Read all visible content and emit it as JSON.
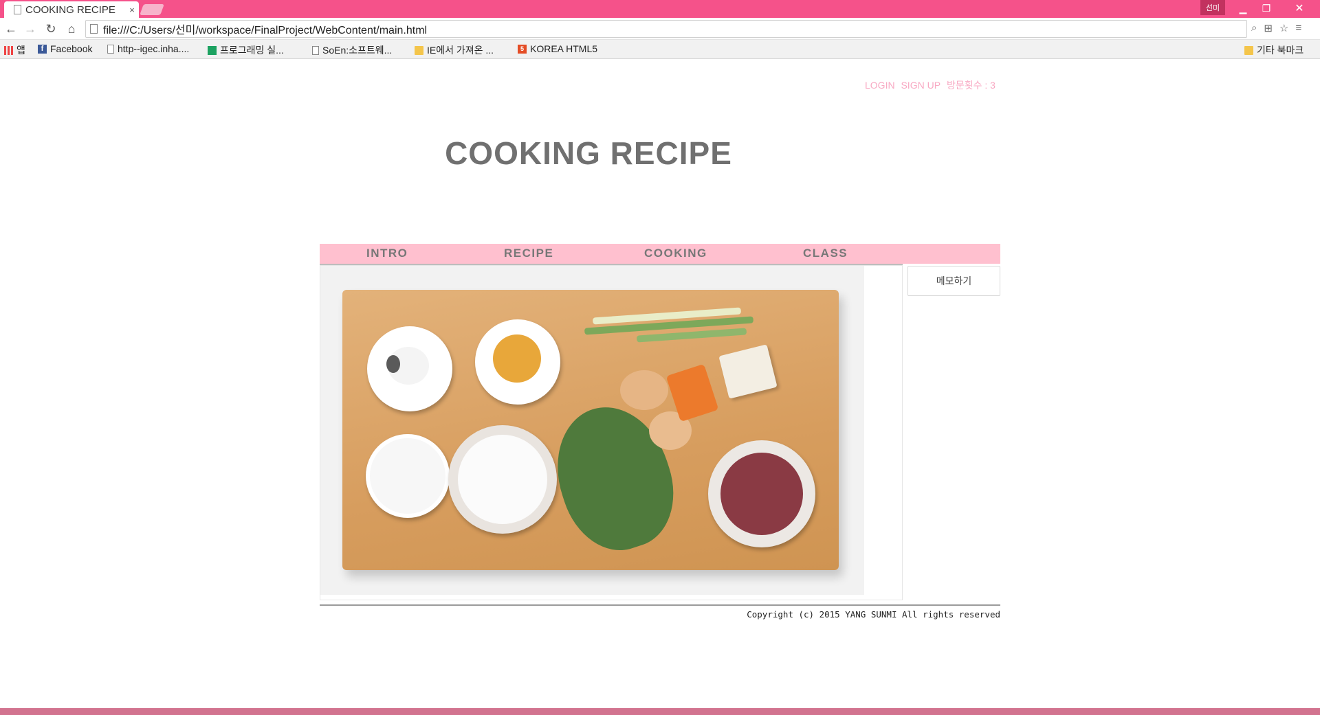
{
  "browser": {
    "tab_title": "COOKING RECIPE",
    "tab_close": "×",
    "profile_name": "선미",
    "url": "file:///C:/Users/선미/workspace/FinalProject/WebContent/main.html",
    "bookmarks": [
      {
        "label": "앱",
        "icon": "apps-icon"
      },
      {
        "label": "Facebook",
        "icon": "facebook-icon"
      },
      {
        "label": "http--igec.inha....",
        "icon": "page-icon"
      },
      {
        "label": "프로그래밍 실...",
        "icon": "sheet-icon"
      },
      {
        "label": "SoEn:소프트웨...",
        "icon": "page-icon"
      },
      {
        "label": "IE에서 가져온 ...",
        "icon": "folder-icon"
      },
      {
        "label": "KOREA HTML5",
        "icon": "html5-icon"
      }
    ],
    "other_bookmarks": "기타 북마크"
  },
  "page": {
    "top_links": {
      "login": "LOGIN",
      "signup": "SIGN UP",
      "visits": "방문횟수 : 3"
    },
    "title": "COOKING RECIPE",
    "menu": [
      "INTRO",
      "RECIPE",
      "COOKING",
      "CLASS"
    ],
    "memo_button": "메모하기",
    "copyright": "Copyright (c) 2015 YANG SUNMI All rights reserved"
  },
  "colors": {
    "chrome_accent": "#f5528a",
    "menu_bg": "#ffc0cf",
    "title_text": "#707070",
    "top_link_text": "#f8a9c3"
  }
}
